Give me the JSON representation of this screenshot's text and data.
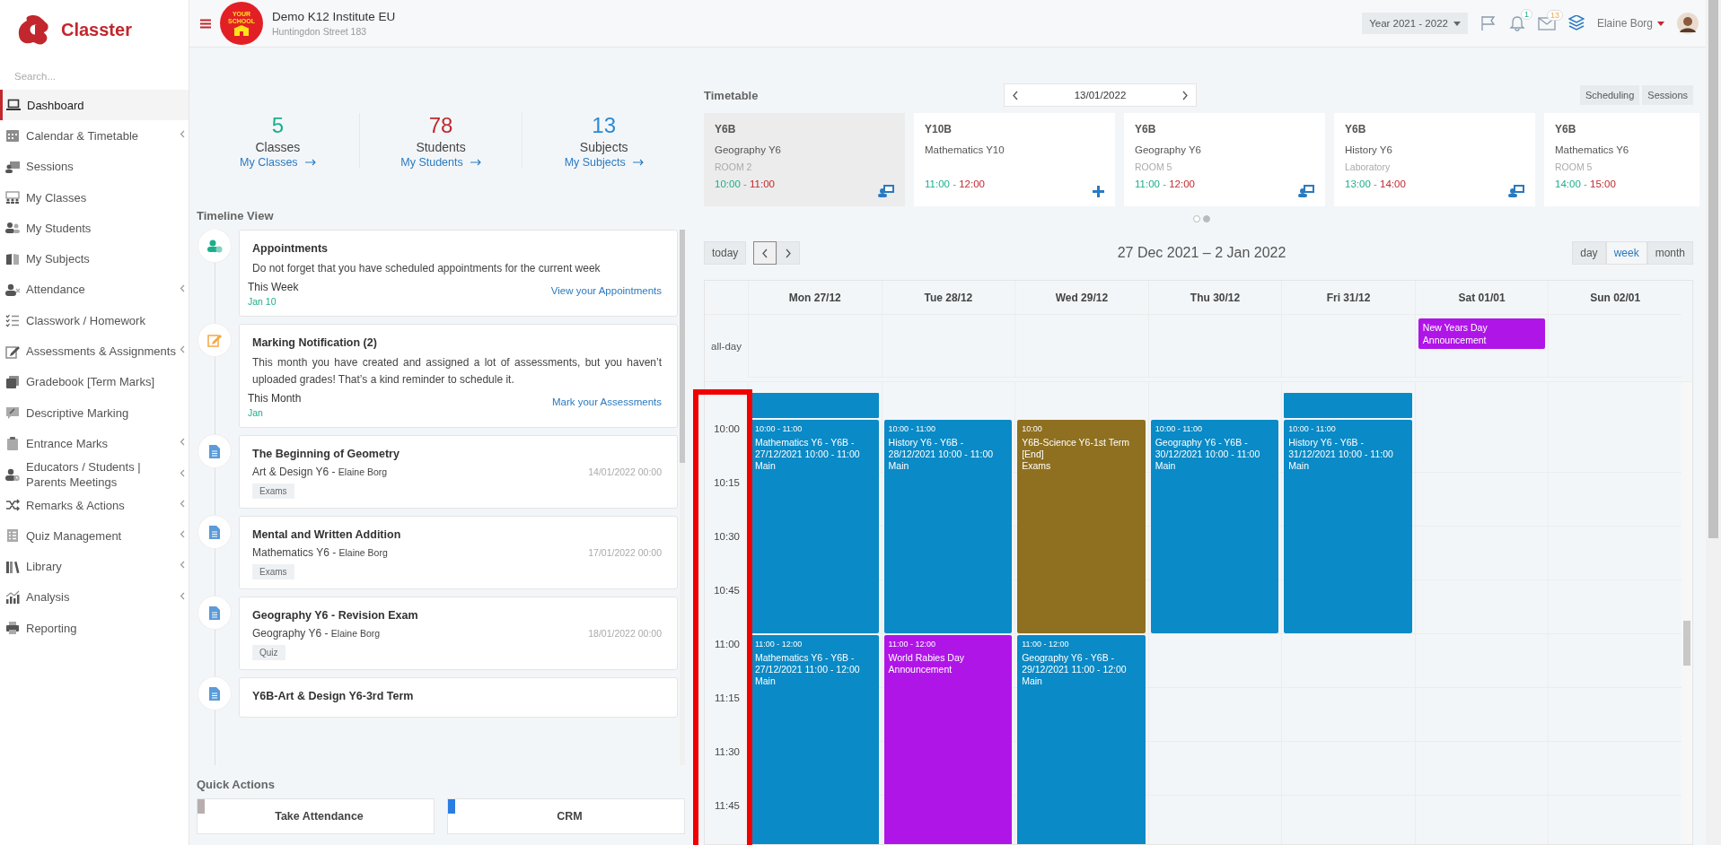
{
  "sidebar": {
    "brand": "Classter",
    "search": {
      "placeholder": "Search..."
    },
    "items": [
      {
        "label": "Dashboard",
        "selected": true,
        "expandable": false
      },
      {
        "label": "Calendar & Timetable",
        "selected": false,
        "expandable": true
      },
      {
        "label": "Sessions",
        "selected": false,
        "expandable": false
      },
      {
        "label": "My Classes",
        "selected": false,
        "expandable": false
      },
      {
        "label": "My Students",
        "selected": false,
        "expandable": false
      },
      {
        "label": "My Subjects",
        "selected": false,
        "expandable": false
      },
      {
        "label": "Attendance",
        "selected": false,
        "expandable": true
      },
      {
        "label": "Classwork / Homework",
        "selected": false,
        "expandable": false
      },
      {
        "label": "Assessments & Assignments",
        "selected": false,
        "expandable": true
      },
      {
        "label": "Gradebook [Term Marks]",
        "selected": false,
        "expandable": false
      },
      {
        "label": "Descriptive Marking",
        "selected": false,
        "expandable": false
      },
      {
        "label": "Entrance Marks",
        "selected": false,
        "expandable": true
      },
      {
        "label": "Educators / Students | Parents Meetings",
        "selected": false,
        "expandable": true
      },
      {
        "label": "Remarks & Actions",
        "selected": false,
        "expandable": true
      },
      {
        "label": "Quiz Management",
        "selected": false,
        "expandable": true
      },
      {
        "label": "Library",
        "selected": false,
        "expandable": true
      },
      {
        "label": "Analysis",
        "selected": false,
        "expandable": true
      },
      {
        "label": "Reporting",
        "selected": false,
        "expandable": false
      }
    ]
  },
  "header": {
    "school_logo": {
      "line_1": "YOUR",
      "line_2": "SCHOOL"
    },
    "school_name": "Demo K12 Institute EU",
    "address": "Huntingdon Street 183",
    "year": "Year 2021 - 2022",
    "notifications_badge": "1",
    "messages_badge": "13",
    "user_name": "Elaine Borg"
  },
  "stats": [
    {
      "value": "5",
      "label": "Classes",
      "link": "My Classes",
      "color": "#1aaf8b"
    },
    {
      "value": "78",
      "label": "Students",
      "link": "My Students",
      "color": "#c0282d"
    },
    {
      "value": "13",
      "label": "Subjects",
      "link": "My Subjects",
      "color": "#2a8ad4"
    }
  ],
  "timeline": {
    "title": "Timeline View",
    "items": [
      {
        "kind": "appointment",
        "title": "Appointments",
        "text": "Do not forget that you have scheduled appointments for the current week",
        "period": "This Week",
        "date": "Jan 10",
        "link": "View your Appointments"
      },
      {
        "kind": "marking",
        "title": "Marking Notification (2)",
        "text": "This month you have created and assigned a lot of assessments, but you haven’t uploaded grades! That’s a kind reminder to schedule it.",
        "period": "This Month",
        "date": "Jan",
        "link": "Mark your Assessments"
      },
      {
        "kind": "document",
        "title": "The Beginning of Geometry",
        "subject": "Art & Design Y6 -",
        "teacher": "Elaine Borg",
        "datetime": "14/01/2022 00:00",
        "tag": "Exams"
      },
      {
        "kind": "document",
        "title": "Mental and Written Addition",
        "subject": "Mathematics Y6 -",
        "teacher": "Elaine Borg",
        "datetime": "17/01/2022 00:00",
        "tag": "Exams"
      },
      {
        "kind": "document",
        "title": "Geography Y6 - Revision Exam",
        "subject": "Geography Y6 -",
        "teacher": "Elaine Borg",
        "datetime": "18/01/2022 00:00",
        "tag": "Quiz"
      },
      {
        "kind": "document",
        "title": "Y6B-Art & Design Y6-3rd Term"
      }
    ]
  },
  "quick_actions": {
    "title": "Quick Actions",
    "items": [
      {
        "label": "Take Attendance",
        "color": "#b9aeae"
      },
      {
        "label": "CRM",
        "color": "#2a7de1"
      }
    ]
  },
  "timetable": {
    "title": "Timetable",
    "date": "13/01/2022",
    "buttons": [
      "Scheduling",
      "Sessions"
    ],
    "cards": [
      {
        "kind": "session",
        "group": "Y6B",
        "subject": "Geography Y6",
        "room": "ROOM 2",
        "start": "10:00",
        "separator": "-",
        "end": "11:00",
        "selected": true
      },
      {
        "kind": "add",
        "group": "Y10B",
        "subject": "Mathematics Y10",
        "start": "11:00",
        "separator": "-",
        "end": "12:00",
        "selected": false
      },
      {
        "kind": "session",
        "group": "Y6B",
        "subject": "Geography Y6",
        "room": "ROOM 5",
        "start": "11:00",
        "separator": "-",
        "end": "12:00",
        "selected": false
      },
      {
        "kind": "session",
        "group": "Y6B",
        "subject": "History Y6",
        "room": "Laboratory",
        "start": "13:00",
        "separator": "-",
        "end": "14:00",
        "selected": false
      },
      {
        "group": "Y6B",
        "subject": "Mathematics Y6",
        "room": "ROOM 5",
        "start": "14:00",
        "separator": "-",
        "end": "15:00",
        "selected": false
      }
    ],
    "dots": [
      {
        "selected": false
      },
      {
        "selected": true
      }
    ]
  },
  "calendar": {
    "today_button": "today",
    "title": "27 Dec 2021 – 2 Jan 2022",
    "views": [
      {
        "label": "day",
        "selected": false
      },
      {
        "label": "week",
        "selected": true
      },
      {
        "label": "month",
        "selected": false
      }
    ],
    "all_day_label": "all-day",
    "times": [
      "10:00",
      "10:15",
      "10:30",
      "10:45",
      "11:00",
      "11:15",
      "11:30",
      "11:45"
    ],
    "days": [
      {
        "label": "Mon 27/12",
        "events": [
          {
            "kind": "early",
            "color": "#0a8ac6"
          },
          {
            "kind": "first_hour",
            "time": "10:00 - 11:00",
            "title": "Mathematics Y6 - Y6B - 27/12/2021 10:00 - 11:00",
            "location": "Main",
            "color": "#0a8ac6"
          },
          {
            "kind": "second_hour",
            "time": "11:00 - 12:00",
            "title": "Mathematics Y6 - Y6B - 27/12/2021 11:00 - 12:00",
            "location": "Main",
            "color": "#0a8ac6"
          }
        ]
      },
      {
        "label": "Tue 28/12",
        "events": [
          {
            "kind": "first_hour",
            "time": "10:00 - 11:00",
            "title": "History Y6 - Y6B - 28/12/2021 10:00 - 11:00",
            "location": "Main",
            "color": "#0a8ac6"
          },
          {
            "kind": "second_hour",
            "time": "11:00 - 12:00",
            "title": "World Rabies Day Announcement",
            "color": "#b015e8"
          }
        ]
      },
      {
        "label": "Wed 29/12",
        "events": [
          {
            "kind": "first_hour",
            "time": "10:00",
            "title": "Y6B-Science Y6-1st Term [End]",
            "location": "Exams",
            "color": "#8f7020"
          },
          {
            "kind": "second_hour",
            "time": "11:00 - 12:00",
            "title": "Geography Y6 - Y6B - 29/12/2021 11:00 - 12:00",
            "location": "Main",
            "color": "#0a8ac6"
          }
        ]
      },
      {
        "label": "Thu 30/12",
        "events": [
          {
            "kind": "first_hour",
            "time": "10:00 - 11:00",
            "title": "Geography Y6 - Y6B - 30/12/2021 10:00 - 11:00",
            "location": "Main",
            "color": "#0a8ac6"
          }
        ]
      },
      {
        "label": "Fri 31/12",
        "events": [
          {
            "kind": "early",
            "color": "#0a8ac6"
          },
          {
            "kind": "first_hour",
            "time": "10:00 - 11:00",
            "title": "History Y6 - Y6B - 31/12/2021 10:00 - 11:00",
            "location": "Main",
            "color": "#0a8ac6"
          }
        ]
      },
      {
        "label": "Sat 01/01",
        "all_day": [
          {
            "title": "New Years Day Announcement",
            "color": "#b015e8"
          }
        ]
      },
      {
        "label": "Sun 02/01"
      }
    ]
  }
}
